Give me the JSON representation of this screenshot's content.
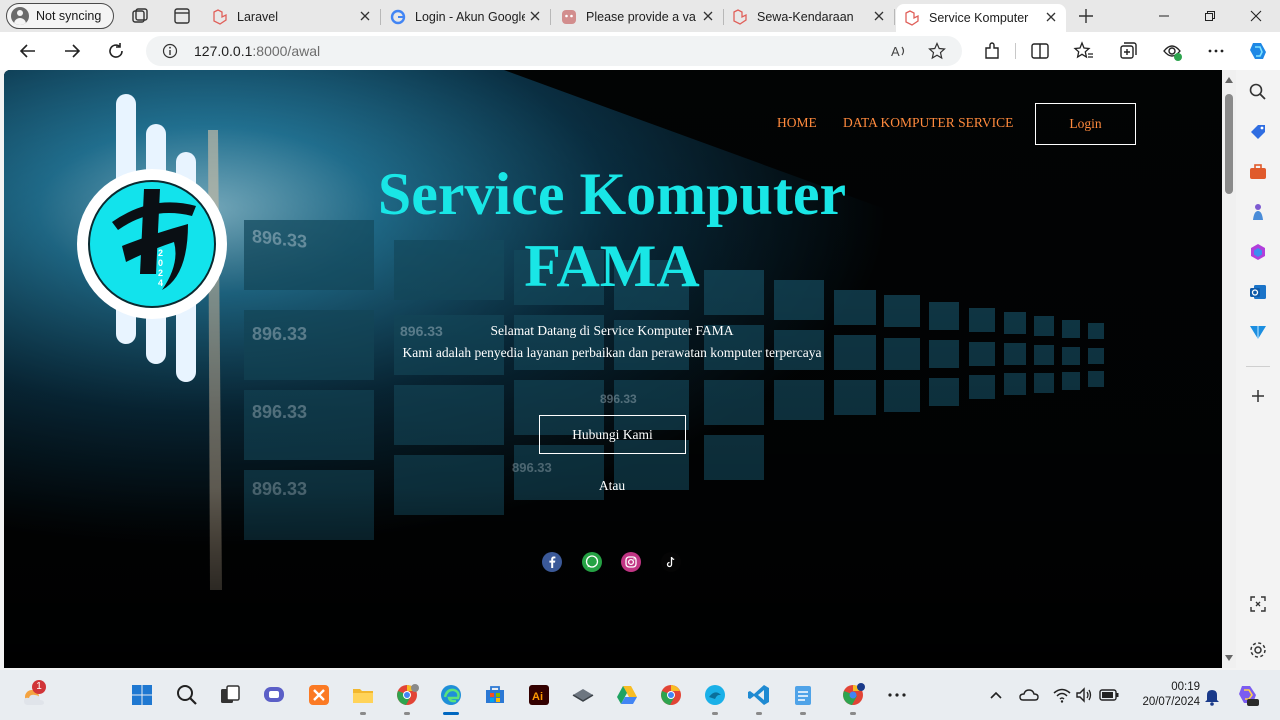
{
  "browser": {
    "profile_label": "Not syncing",
    "tabs": [
      {
        "title": "Laravel",
        "favicon": "laravel-icon"
      },
      {
        "title": "Login - Akun Google",
        "favicon": "google-icon"
      },
      {
        "title": "Please provide a valid",
        "favicon": "chat-icon"
      },
      {
        "title": "Sewa-Kendaraan",
        "favicon": "laravel-icon"
      },
      {
        "title": "Service Komputer",
        "favicon": "laravel-icon"
      }
    ],
    "url_host": "127.0.0.1",
    "url_path": ":8000/awal"
  },
  "site": {
    "nav": {
      "home": "HOME",
      "data": "DATA KOMPUTER SERVICE",
      "login": "Login"
    },
    "title_line1": "Service Komputer",
    "title_line2": "FAMA",
    "welcome": "Selamat Datang di Service Komputer FAMA",
    "tagline": "Kami adalah penyedia layanan perbaikan dan perawatan komputer terpercaya",
    "contact_button": "Hubungi Kami",
    "or_text": "Atau",
    "socials": [
      "facebook-icon",
      "whatsapp-icon",
      "instagram-icon",
      "tiktok-icon"
    ],
    "colors": {
      "title": "#19e6e6",
      "nav": "#ff8a3d",
      "logo": "#19e6e6"
    }
  },
  "taskbar": {
    "weather_badge": "1",
    "clock_time": "00:19",
    "clock_date": "20/07/2024"
  }
}
